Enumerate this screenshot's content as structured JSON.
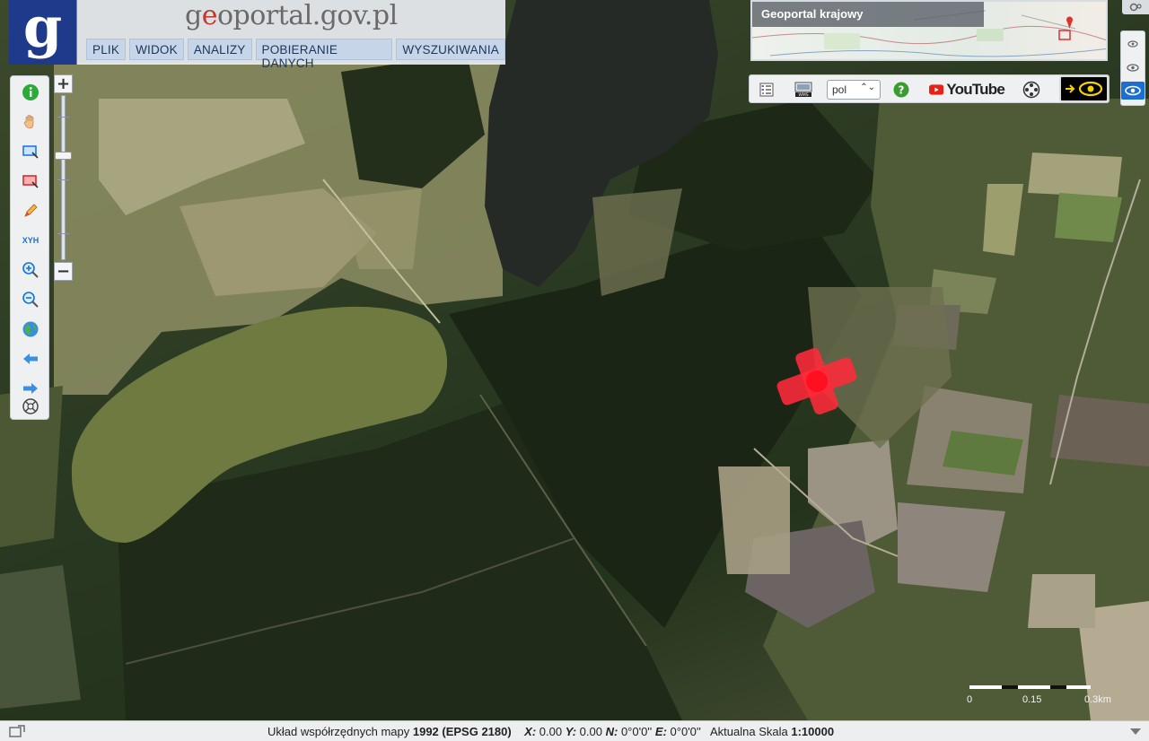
{
  "header": {
    "logo_letter": "g",
    "site_title_prefix": "g",
    "site_title_mark": "e",
    "site_title_rest": "oportal.gov.pl",
    "menu": [
      {
        "label": "PLIK"
      },
      {
        "label": "WIDOK"
      },
      {
        "label": "ANALIZY"
      },
      {
        "label": "POBIERANIE DANYCH"
      },
      {
        "label": "WYSZUKIWANIA"
      }
    ]
  },
  "overview": {
    "title": "Geoportal krajowy"
  },
  "right_toolbar": {
    "language": "pol",
    "youtube_label": "YouTube"
  },
  "toolbar_icons": [
    "info-icon",
    "pan-hand-icon",
    "zoom-box-icon",
    "select-box-icon",
    "pencil-icon",
    "xyh-icon",
    "zoom-in-icon",
    "zoom-out-icon",
    "globe-icon",
    "back-arrow-icon",
    "forward-arrow-icon",
    "scale-wheel-icon"
  ],
  "toolbar_xyh_label": "XYH",
  "scalebar": {
    "labels": [
      "0",
      "0.15",
      "0.3km"
    ]
  },
  "status": {
    "coord_system_label": "Układ współrzędnych mapy",
    "coord_system_value": "1992 (EPSG 2180)",
    "x_label": "X:",
    "x_value": "0.00",
    "y_label": "Y:",
    "y_value": "0.00",
    "n_label": "N:",
    "n_value": "0°0'0''",
    "e_label": "E:",
    "e_value": "0°0'0''",
    "scale_label": "Aktualna Skala",
    "scale_value": "1:10000"
  },
  "colors": {
    "logo_bg": "#1f3a8a",
    "menu_bg": "#c6d6e8",
    "marker": "#ff2a3a",
    "lake": "#6f7a40",
    "dark_lake": "#262a26"
  }
}
